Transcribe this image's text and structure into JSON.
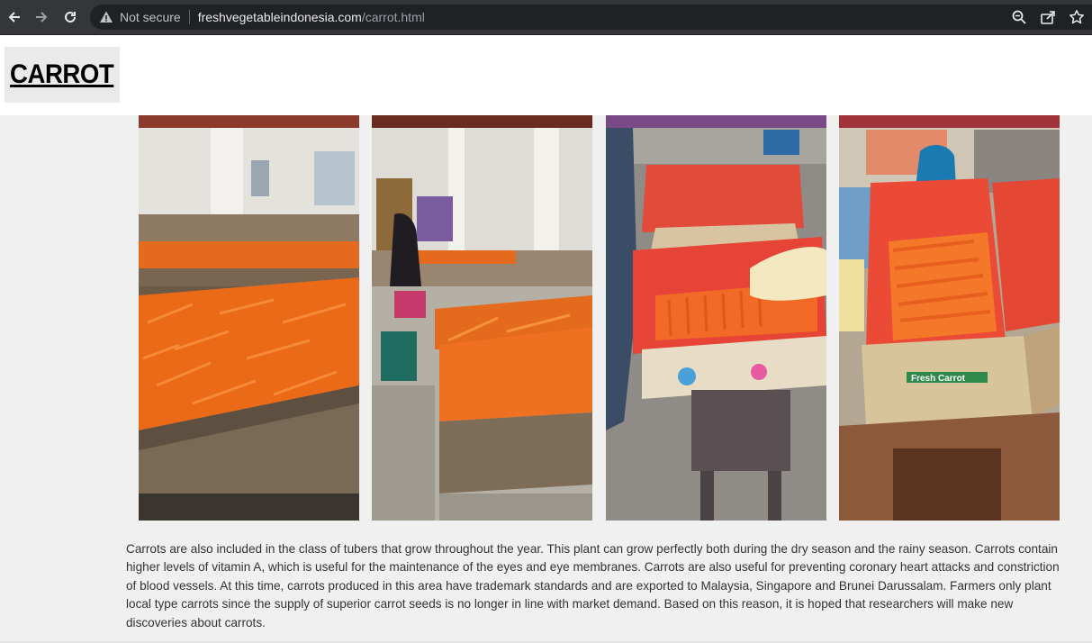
{
  "browser": {
    "security_label": "Not secure",
    "url_host": "freshvegetableindonesia.com",
    "url_path": "/carrot.html",
    "icons": [
      "back-arrow-icon",
      "forward-arrow-icon",
      "reload-icon",
      "warning-icon",
      "zoom-icon",
      "share-icon",
      "bookmark-star-icon"
    ]
  },
  "header": {
    "title": "CARROT"
  },
  "gallery": {
    "photos": [
      {
        "subject": "carrot-bins-warehouse-1"
      },
      {
        "subject": "carrot-bins-warehouse-2"
      },
      {
        "subject": "carrot-box-red-liner"
      },
      {
        "subject": "fresh-carrot-box-packed"
      }
    ],
    "box_label": "Fresh Carrot"
  },
  "content": {
    "description": "Carrots are also included in the class of tubers that grow throughout the year. This plant can grow perfectly both during the dry season and the rainy season. Carrots contain higher levels of vitamin A, which is useful for the maintenance of the eyes and eye membranes. Carrots are also useful for preventing coronary heart attacks and constriction of blood vessels. At this time, carrots produced in this area have trademark standards and are exported to Malaysia, Singapore and Brunei Darussalam. Farmers only plant local type carrots since the supply of superior carrot seeds is no longer in line with market demand. Based on this reason, it is hoped that researchers will make new discoveries about carrots."
  },
  "colors": {
    "browser_chrome": "#35363a",
    "omnibox": "#202124",
    "page_bg": "#f0f0f0",
    "carrot": "#f07020"
  }
}
